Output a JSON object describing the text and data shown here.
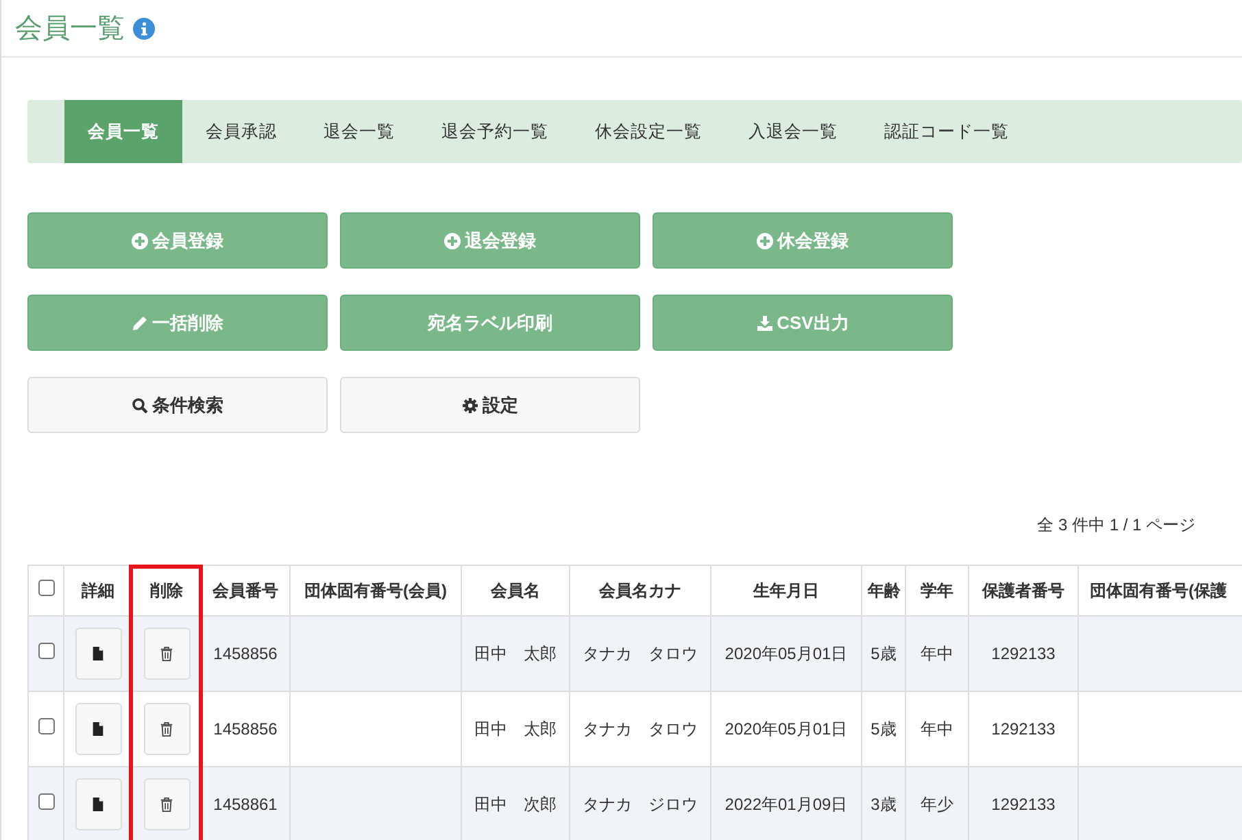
{
  "page_title": "会員一覧",
  "tabs": [
    {
      "label": "会員一覧",
      "selected": true
    },
    {
      "label": "会員承認",
      "selected": false
    },
    {
      "label": "退会一覧",
      "selected": false
    },
    {
      "label": "退会予約一覧",
      "selected": false
    },
    {
      "label": "休会設定一覧",
      "selected": false
    },
    {
      "label": "入退会一覧",
      "selected": false
    },
    {
      "label": "認証コード一覧",
      "selected": false
    }
  ],
  "buttons": [
    {
      "label": "会員登録",
      "kind": "primary"
    },
    {
      "label": "退会登録",
      "kind": "primary"
    },
    {
      "label": "休会登録",
      "kind": "primary"
    },
    {
      "label": "一括削除",
      "kind": "primary"
    },
    {
      "label": "宛名ラベル印刷",
      "kind": "primary"
    },
    {
      "label": "CSV出力",
      "kind": "primary"
    },
    {
      "label": "条件検索",
      "kind": "default"
    },
    {
      "label": "設定",
      "kind": "default"
    }
  ],
  "pagination": "全 3 件中 1 / 1 ページ",
  "table": {
    "select_all_checked": false,
    "columns": [
      {
        "label": "詳細",
        "kind": "detail",
        "highlighted": false
      },
      {
        "label": "削除",
        "kind": "delete",
        "highlighted": true
      },
      {
        "label": "会員番号",
        "highlighted": false
      },
      {
        "label": "団体固有番号(会員)",
        "highlighted": false
      },
      {
        "label": "会員名",
        "highlighted": false
      },
      {
        "label": "会員名カナ",
        "highlighted": false
      },
      {
        "label": "生年月日",
        "highlighted": false
      },
      {
        "label": "年齢",
        "highlighted": false
      },
      {
        "label": "学年",
        "highlighted": false
      },
      {
        "label": "保護者番号",
        "highlighted": false
      },
      {
        "label": "団体固有番号(保護",
        "highlighted": false
      }
    ],
    "rows": [
      {
        "checked": false,
        "cells": [
          "",
          "",
          "1458856",
          "",
          "田中　太郎",
          "タナカ　タロウ",
          "2020年05月01日",
          "5歳",
          "年中",
          "1292133",
          ""
        ]
      },
      {
        "checked": false,
        "cells": [
          "",
          "",
          "1458856",
          "",
          "田中　太郎",
          "タナカ　タロウ",
          "2020年05月01日",
          "5歳",
          "年中",
          "1292133",
          ""
        ]
      },
      {
        "checked": false,
        "cells": [
          "",
          "",
          "1458861",
          "",
          "田中　次郎",
          "タナカ　ジロウ",
          "2022年01月09日",
          "3歳",
          "年少",
          "1292133",
          ""
        ]
      }
    ]
  }
}
